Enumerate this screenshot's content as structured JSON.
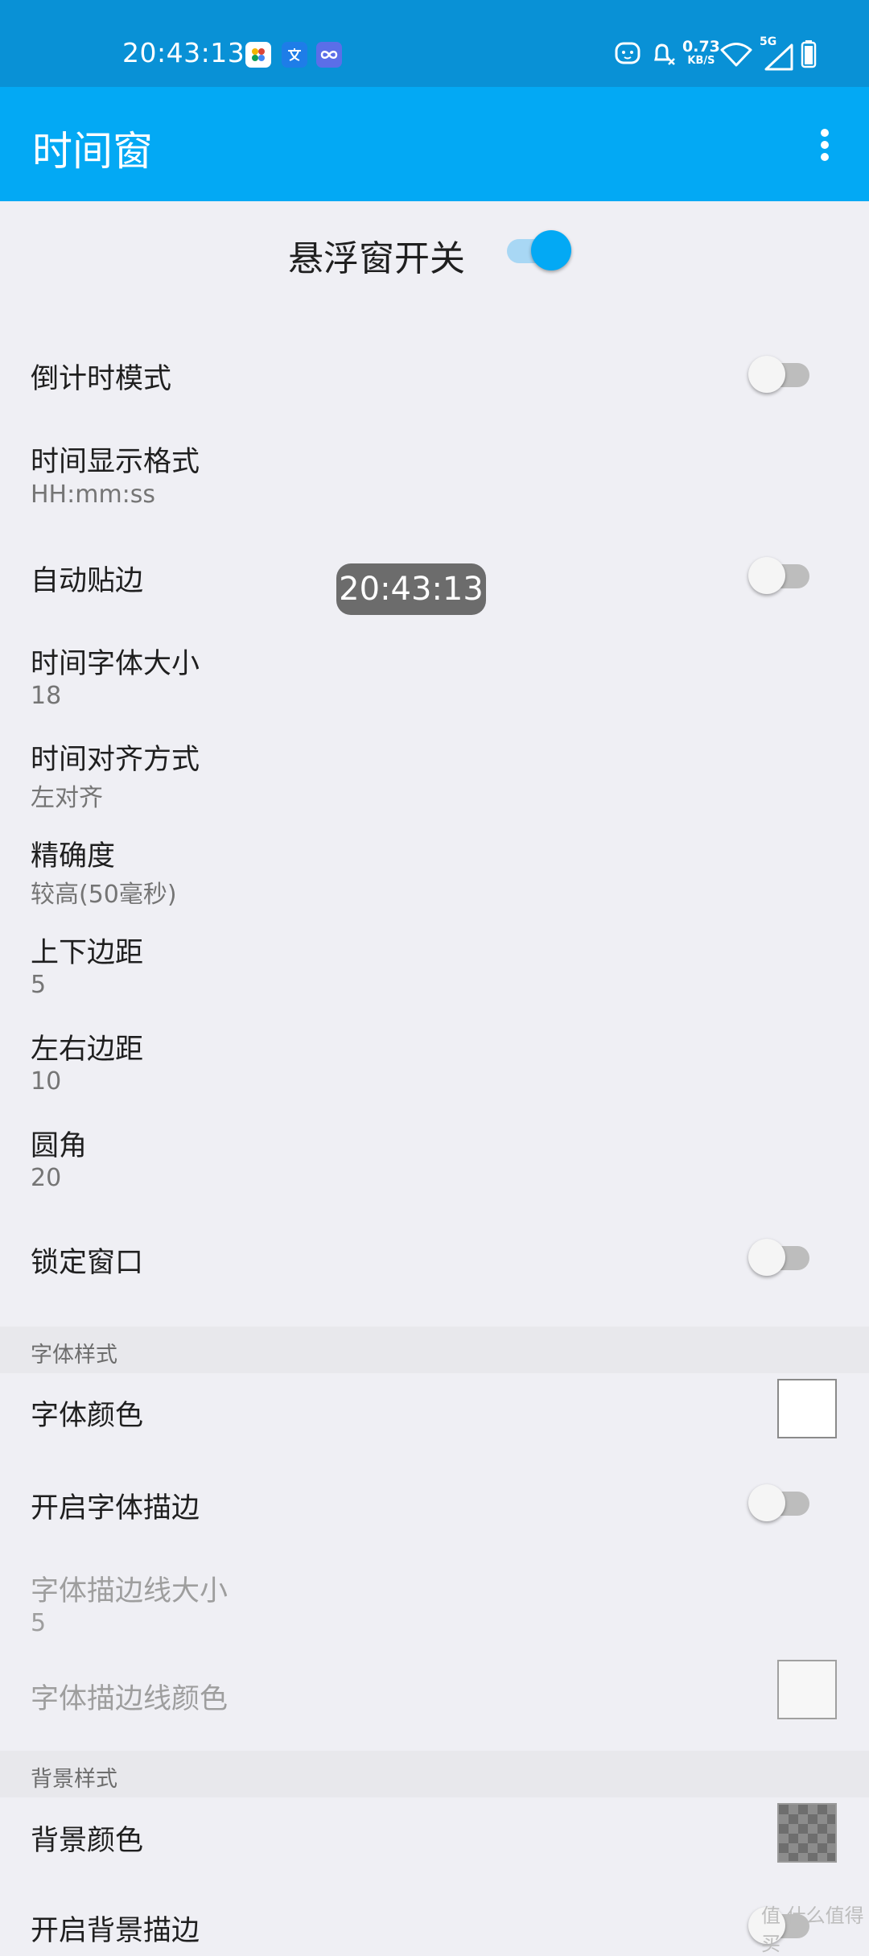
{
  "status_bar": {
    "time": "20:43:13",
    "speed_value": "0.73",
    "speed_unit": "KB/S",
    "network_type": "5G",
    "app_icons": [
      "colorful-app-icon",
      "translate-app-icon",
      "infinity-app-icon"
    ],
    "right_icons": [
      "face-icon",
      "bell-muted-icon",
      "wifi-icon",
      "signal-icon",
      "battery-icon"
    ]
  },
  "app_bar": {
    "title": "时间窗",
    "background": "#03a9f4"
  },
  "master": {
    "label": "悬浮窗开关",
    "enabled": true
  },
  "floating_clock": {
    "time": "20:43:13"
  },
  "prefs": [
    {
      "title": "倒计时模式",
      "switch": false
    },
    {
      "title": "时间显示格式",
      "summary": "HH:mm:ss"
    },
    {
      "title": "自动贴边",
      "switch": false
    },
    {
      "title": "时间字体大小",
      "summary": "18"
    },
    {
      "title": "时间对齐方式",
      "summary": "左对齐"
    },
    {
      "title": "精确度",
      "summary": "较高(50毫秒)"
    },
    {
      "title": "上下边距",
      "summary": "5"
    },
    {
      "title": "左右边距",
      "summary": "10"
    },
    {
      "title": "圆角",
      "summary": "20"
    },
    {
      "title": "锁定窗口",
      "switch": false
    }
  ],
  "font_section": {
    "header": "字体样式",
    "items": [
      {
        "title": "字体颜色",
        "color": "#ffffff"
      },
      {
        "title": "开启字体描边",
        "switch": false
      },
      {
        "title": "字体描边线大小",
        "summary": "5",
        "disabled": true
      },
      {
        "title": "字体描边线颜色",
        "color": "#f7f7f7",
        "disabled": true
      }
    ]
  },
  "bg_section": {
    "header": "背景样式",
    "items": [
      {
        "title": "背景颜色",
        "color": "checkered-gray"
      },
      {
        "title": "开启背景描边",
        "switch": false
      }
    ]
  },
  "watermark": "值 什么值得买"
}
